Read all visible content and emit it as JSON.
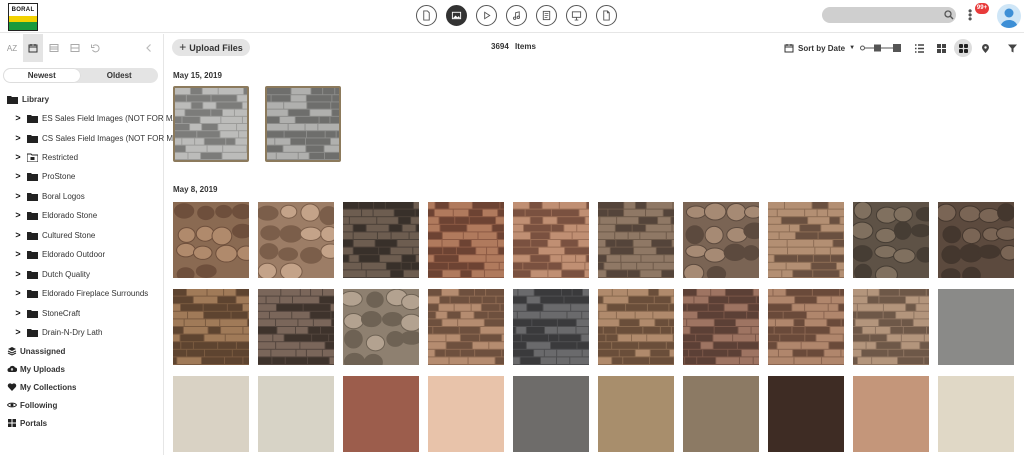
{
  "brand": {
    "logo_text": "BORAL",
    "colors": {
      "yellow": "#f2d200",
      "green": "#1a9a3c"
    }
  },
  "topnav": {
    "icons": [
      {
        "name": "document-icon",
        "active": false
      },
      {
        "name": "image-icon",
        "active": true
      },
      {
        "name": "video-icon",
        "active": false
      },
      {
        "name": "audio-icon",
        "active": false
      },
      {
        "name": "text-file-icon",
        "active": false
      },
      {
        "name": "presentation-icon",
        "active": false
      },
      {
        "name": "other-file-icon",
        "active": false
      }
    ],
    "search": {
      "value": "",
      "placeholder": ""
    },
    "notification_badge": "99+"
  },
  "sidebar": {
    "tools": [
      {
        "name": "sort-az-tool",
        "label": "AZ"
      },
      {
        "name": "calendar-tool",
        "label": ""
      },
      {
        "name": "list-tool",
        "label": ""
      },
      {
        "name": "layout-tool",
        "label": ""
      },
      {
        "name": "undo-tool",
        "label": ""
      },
      {
        "name": "collapse-tool",
        "label": ""
      }
    ],
    "order": {
      "newest": "Newest",
      "oldest": "Oldest",
      "selected": "newest"
    },
    "library_label": "Library",
    "folders": [
      "ES Sales Field Images (NOT FOR MAR",
      "CS Sales Field Images (NOT FOR MAR",
      "Restricted",
      "ProStone",
      "Boral Logos",
      "Eldorado Stone",
      "Cultured Stone",
      "Eldorado Outdoor",
      "Dutch Quality",
      "Eldorado Fireplace Surrounds",
      "StoneCraft",
      "Drain-N-Dry Lath"
    ],
    "sections": [
      "Unassigned",
      "My Uploads",
      "My Collections",
      "Following",
      "Portals"
    ]
  },
  "toolbar": {
    "upload_label": "Upload Files",
    "count": "3694",
    "count_label": "Items",
    "sort_label": "Sort by Date"
  },
  "groups": [
    {
      "date": "May 15, 2019",
      "count": 2
    },
    {
      "date": "May 8, 2019",
      "count": 30
    }
  ]
}
